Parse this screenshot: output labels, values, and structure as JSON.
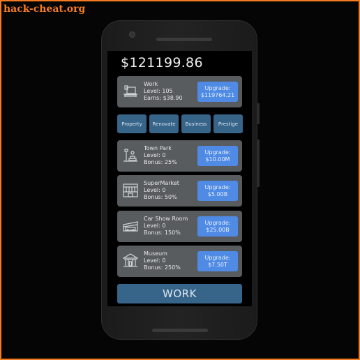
{
  "watermark": "hack-cheat.org",
  "balance": "$121199.86",
  "work_card": {
    "title": "Work",
    "level": "Level: 105",
    "earns": "Earns: $38.90",
    "upgrade_label": "Upgrade:",
    "upgrade_cost": "$119764.21",
    "icon": "computer-desk-icon"
  },
  "tabs": [
    {
      "label": "Property"
    },
    {
      "label": "Renovate"
    },
    {
      "label": "Business"
    },
    {
      "label": "Prestige"
    }
  ],
  "properties": [
    {
      "name": "Town Park",
      "level": "Level: 0",
      "bonus": "Bonus: 25%",
      "upgrade_label": "Upgrade:",
      "upgrade_cost": "$10.00M",
      "icon": "park-icon"
    },
    {
      "name": "SuperMarket",
      "level": "Level: 0",
      "bonus": "Bonus: 50%",
      "upgrade_label": "Upgrade:",
      "upgrade_cost": "$5.00B",
      "icon": "supermarket-icon"
    },
    {
      "name": "Car Show Room",
      "level": "Level: 0",
      "bonus": "Bonus: 150%",
      "upgrade_label": "Upgrade:",
      "upgrade_cost": "$25.00B",
      "icon": "car-showroom-icon"
    },
    {
      "name": "Museum",
      "level": "Level: 0",
      "bonus": "Bonus: 250%",
      "upgrade_label": "Upgrade:",
      "upgrade_cost": "$7.50T",
      "icon": "museum-icon"
    }
  ],
  "work_button": "WORK",
  "colors": {
    "accent_blue": "#4f8be5",
    "tab_blue": "#376489",
    "card_gray": "#585c5e",
    "watermark_orange": "#f47b20"
  }
}
